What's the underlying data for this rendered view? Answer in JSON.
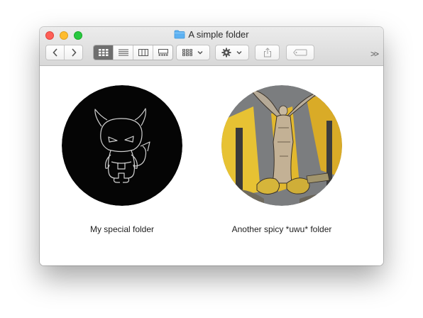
{
  "window": {
    "title": "A simple folder",
    "folder_icon": "folder-icon"
  },
  "toolbar": {
    "back_icon": "chevron-left-icon",
    "forward_icon": "chevron-right-icon",
    "view_modes": [
      "icon-view-icon",
      "list-view-icon",
      "column-view-icon",
      "gallery-view-icon"
    ],
    "active_view": "icon-view-icon",
    "group_icon": "grid-group-icon",
    "action_icon": "gear-icon",
    "share_icon": "share-icon",
    "tag_icon": "tag-icon",
    "overflow_label": ">>"
  },
  "items": [
    {
      "label": "My special folder",
      "icon": "devil-folder-icon"
    },
    {
      "label": "Another spicy *uwu* folder",
      "icon": "art-folder-icon"
    }
  ],
  "colors": {
    "traffic_red": "#fe5f57",
    "traffic_yellow": "#febc2e",
    "traffic_green": "#28c840",
    "folder_blue": "#5db1f2"
  }
}
